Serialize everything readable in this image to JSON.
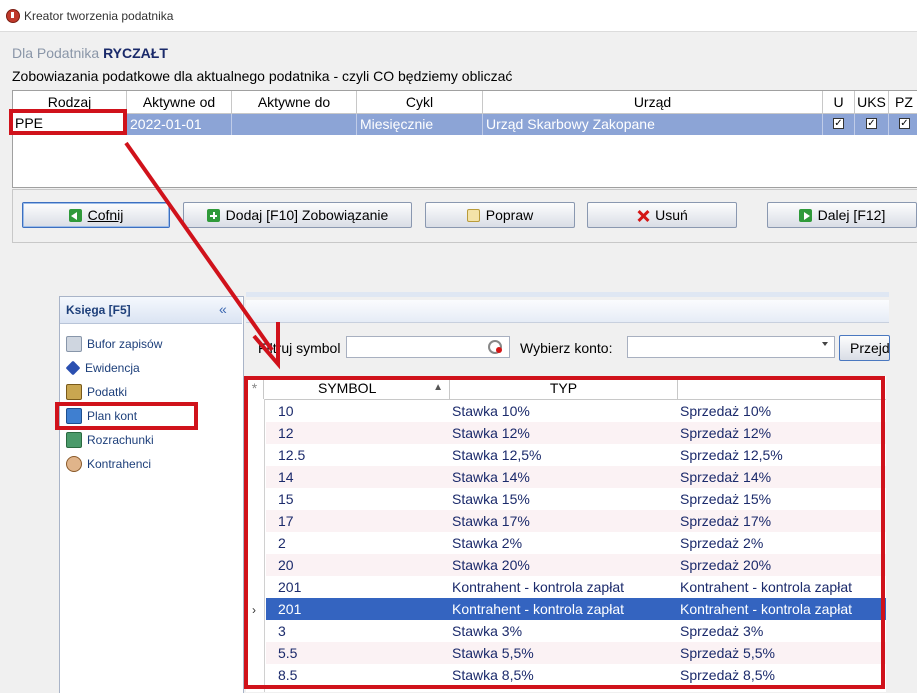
{
  "window": {
    "title": "Kreator tworzenia podatnika"
  },
  "header": {
    "for_label": "Dla Podatnika",
    "taxpayer_type": "RYCZAŁT",
    "subheading": "Zobowiazania podatkowe dla aktualnego podatnika - czyli CO będziemy obliczać"
  },
  "top_grid": {
    "columns": [
      "Rodzaj",
      "Aktywne od",
      "Aktywne do",
      "Cykl",
      "Urząd",
      "U",
      "UKS",
      "PZ"
    ],
    "rows": [
      {
        "rodzaj": "PPE",
        "aktywne_od": "2022-01-01",
        "aktywne_do": "",
        "cykl": "Miesięcznie",
        "urzad": "Urząd Skarbowy Zakopane",
        "u": true,
        "uks": true,
        "pz": true
      }
    ]
  },
  "buttons": {
    "back": "Cofnij",
    "add": "Dodaj [F10] Zobowiązanie",
    "edit": "Popraw",
    "delete": "Usuń",
    "next": "Dalej [F12]"
  },
  "nav": {
    "header": "Księga [F5]",
    "items": [
      {
        "label": "Bufor zapisów",
        "icon": "buffer-icon"
      },
      {
        "label": "Ewidencja",
        "icon": "diamond-icon"
      },
      {
        "label": "Podatki",
        "icon": "taxes-icon"
      },
      {
        "label": "Plan kont",
        "icon": "chart-of-accounts-icon"
      },
      {
        "label": "Rozrachunki",
        "icon": "settlements-icon"
      },
      {
        "label": "Kontrahenci",
        "icon": "contractors-icon"
      }
    ]
  },
  "filter": {
    "symbol_label": "Filtruj symbol",
    "symbol_value": "",
    "account_label": "Wybierz konto:",
    "account_value": "",
    "go_button": "Przejdź"
  },
  "data_grid": {
    "columns": [
      "SYMBOL",
      "TYP",
      ""
    ],
    "rows": [
      {
        "symbol": "10",
        "typ": "Stawka 10%",
        "opis": "Sprzedaż 10%"
      },
      {
        "symbol": "12",
        "typ": "Stawka 12%",
        "opis": "Sprzedaż 12%"
      },
      {
        "symbol": "12.5",
        "typ": "Stawka 12,5%",
        "opis": "Sprzedaż 12,5%"
      },
      {
        "symbol": "14",
        "typ": "Stawka 14%",
        "opis": "Sprzedaż 14%"
      },
      {
        "symbol": "15",
        "typ": "Stawka 15%",
        "opis": "Sprzedaż 15%"
      },
      {
        "symbol": "17",
        "typ": "Stawka 17%",
        "opis": "Sprzedaż 17%"
      },
      {
        "symbol": "2",
        "typ": "Stawka 2%",
        "opis": "Sprzedaż 2%"
      },
      {
        "symbol": "20",
        "typ": "Stawka 20%",
        "opis": "Sprzedaż 20%"
      },
      {
        "symbol": "201",
        "typ": "Kontrahent - kontrola zapłat",
        "opis": "Kontrahent - kontrola zapłat"
      },
      {
        "symbol": "201",
        "typ": "Kontrahent - kontrola zapłat",
        "opis": "Kontrahent - kontrola zapłat"
      },
      {
        "symbol": "3",
        "typ": "Stawka 3%",
        "opis": "Sprzedaż 3%"
      },
      {
        "symbol": "5.5",
        "typ": "Stawka 5,5%",
        "opis": "Sprzedaż 5,5%"
      },
      {
        "symbol": "8.5",
        "typ": "Stawka 8,5%",
        "opis": "Sprzedaż 8,5%"
      }
    ],
    "selected_row_index": 9
  },
  "colors": {
    "annotation_red": "#d0121b",
    "selection_blue": "#3464c0",
    "top_selection": "#8ca4d6"
  }
}
